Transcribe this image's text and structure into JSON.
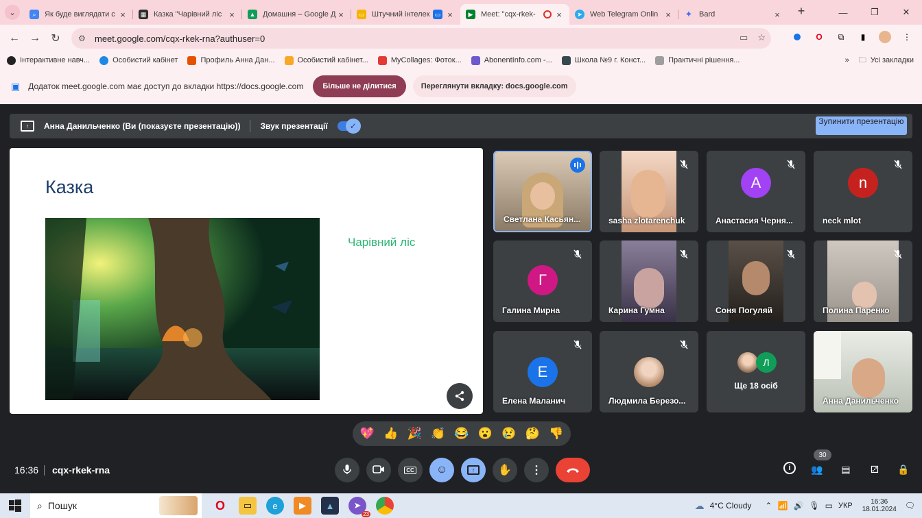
{
  "browser": {
    "tabs": [
      {
        "label": "Як буде виглядати с",
        "icon": "search-icon",
        "color": "#4285f4"
      },
      {
        "label": "Казка \"Чарівний ліс",
        "icon": "image-icon",
        "color": "#2d2d2d"
      },
      {
        "label": "Домашня – Google Д",
        "icon": "drive-icon",
        "color": "#0f9d58"
      },
      {
        "label": "Штучний інтелек",
        "icon": "slides-icon",
        "color": "#f4b400"
      },
      {
        "label": "Meet: \"cqx-rkek-",
        "icon": "meet-icon",
        "color": "#00832d"
      },
      {
        "label": "Web Telegram Onlin",
        "icon": "telegram-icon",
        "color": "#2aabee"
      },
      {
        "label": "Bard",
        "icon": "bard-icon",
        "color": "#4a6cf7"
      }
    ],
    "new_tab": "+",
    "url": "meet.google.com/cqx-rkek-rna?authuser=0",
    "bookmarks": [
      {
        "label": "Інтерактивне навч...",
        "color": "#222"
      },
      {
        "label": "Особистий кабінет",
        "color": "#1e88e5"
      },
      {
        "label": "Профиль Анна Дан...",
        "color": "#e65100"
      },
      {
        "label": "Особистий кабінет...",
        "color": "#f9a825"
      },
      {
        "label": "MyCollages: Фоток...",
        "color": "#e53935"
      },
      {
        "label": "AbonentInfo.com -...",
        "color": "#6a5acd"
      },
      {
        "label": "Школа №9 г. Конст...",
        "color": "#37474f"
      },
      {
        "label": "Практичні рішення...",
        "color": "#9e9e9e"
      }
    ],
    "bookmarks_more": "»",
    "all_bookmarks": "Усі закладки"
  },
  "infobar": {
    "message": "Додаток meet.google.com має доступ до вкладки https://docs.google.com",
    "stop_sharing": "Більше не ділитися",
    "view_tab": "Переглянути вкладку: docs.google.com"
  },
  "presenting": {
    "who": "Анна Данильченко (Ви (показуєте презентацію))",
    "sound_label": "Звук презентації",
    "sound_on": true,
    "stop_label": "Зупинити презентацію"
  },
  "slide": {
    "title": "Казка",
    "subtitle": "Чарівний ліс"
  },
  "participants": [
    {
      "name": "Светлана Касьян...",
      "type": "video",
      "speaking": true,
      "muted": false
    },
    {
      "name": "sasha zlotarenchuk",
      "type": "video",
      "muted": true
    },
    {
      "name": "Анастасия Черня...",
      "type": "avatar",
      "letter": "А",
      "color": "#a142f4",
      "muted": true
    },
    {
      "name": "neck mlot",
      "type": "avatar",
      "letter": "n",
      "color": "#c5221f",
      "muted": true
    },
    {
      "name": "Галина Мирна",
      "type": "avatar",
      "letter": "Г",
      "color": "#d01884",
      "muted": true
    },
    {
      "name": "Карина Гумна",
      "type": "video",
      "muted": true
    },
    {
      "name": "Соня Погуляй",
      "type": "video",
      "muted": true
    },
    {
      "name": "Полина Паренко",
      "type": "video",
      "muted": true
    },
    {
      "name": "Елена Маланич",
      "type": "avatar",
      "letter": "Е",
      "color": "#1a73e8",
      "muted": true
    },
    {
      "name": "Людмила Березо...",
      "type": "photo",
      "muted": true
    },
    {
      "name": "Ще 18 осіб",
      "type": "more",
      "letter": "Л",
      "color": "#0f9d58"
    },
    {
      "name": "Анна Данильченко",
      "type": "video",
      "muted": false
    }
  ],
  "reactions": [
    "💖",
    "👍",
    "🎉",
    "👏",
    "😂",
    "😮",
    "😢",
    "🤔",
    "👎"
  ],
  "meeting": {
    "time": "16:36",
    "code": "cqx-rkek-rna",
    "participant_count": "30"
  },
  "taskbar": {
    "search": "Пошук",
    "weather": "4°C  Cloudy",
    "lang": "УКР",
    "time": "16:36",
    "date": "18.01.2024",
    "telegram_badge": "23"
  }
}
